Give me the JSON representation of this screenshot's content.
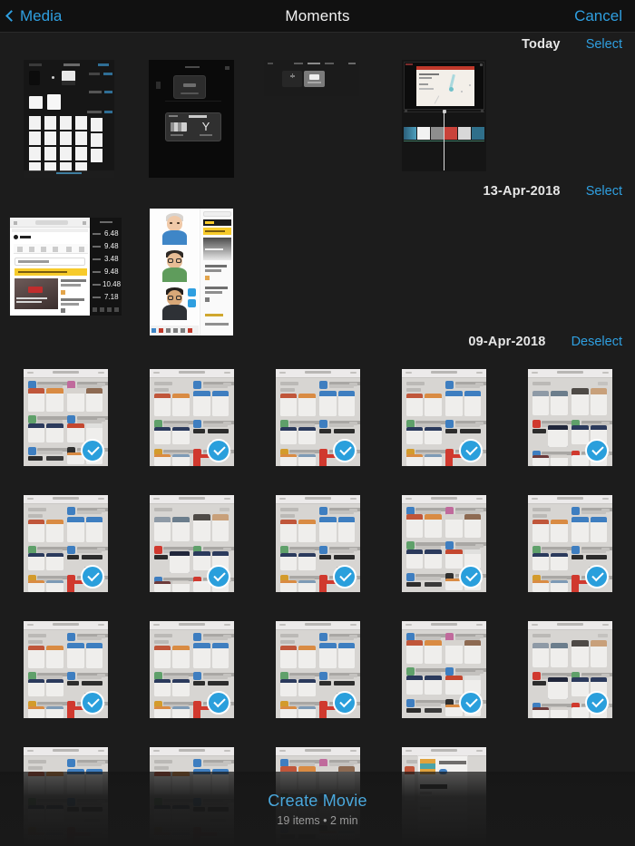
{
  "navbar": {
    "back_label": "Media",
    "back_icon": "chevron-left-icon",
    "title": "Moments",
    "cancel_label": "Cancel"
  },
  "sections": [
    {
      "id": "today",
      "date_label": "Today",
      "action_label": "Select",
      "action_state": "unselected",
      "thumbnails": [
        {
          "id": "t1",
          "kind": "moments-screenshot",
          "selected": false
        },
        {
          "id": "t2",
          "kind": "imovie-new-project-dialog",
          "selected": false
        },
        {
          "id": "t3",
          "kind": "imovie-projects-dark",
          "selected": false
        },
        {
          "id": "t4",
          "kind": "imovie-timeline-map",
          "selected": false
        }
      ]
    },
    {
      "id": "apr13",
      "date_label": "13-Apr-2018",
      "action_label": "Select",
      "action_state": "unselected",
      "thumbnails": [
        {
          "id": "a1",
          "kind": "browser-article-dark-sidebar",
          "selected": false
        },
        {
          "id": "a2",
          "kind": "memoji-avatars",
          "selected": false
        }
      ]
    },
    {
      "id": "apr09",
      "date_label": "09-Apr-2018",
      "action_label": "Deselect",
      "action_state": "selected",
      "thumbnails": [
        {
          "id": "b01",
          "kind": "appstore-a",
          "selected": true
        },
        {
          "id": "b02",
          "kind": "appstore-b",
          "selected": true
        },
        {
          "id": "b03",
          "kind": "appstore-b",
          "selected": true
        },
        {
          "id": "b04",
          "kind": "appstore-b",
          "selected": true
        },
        {
          "id": "b05",
          "kind": "appstore-c",
          "selected": true
        },
        {
          "id": "b06",
          "kind": "appstore-b",
          "selected": true
        },
        {
          "id": "b07",
          "kind": "appstore-c",
          "selected": true
        },
        {
          "id": "b08",
          "kind": "appstore-b",
          "selected": true
        },
        {
          "id": "b09",
          "kind": "appstore-a",
          "selected": true
        },
        {
          "id": "b10",
          "kind": "appstore-b",
          "selected": true
        },
        {
          "id": "b11",
          "kind": "appstore-b",
          "selected": true
        },
        {
          "id": "b12",
          "kind": "appstore-b",
          "selected": true
        },
        {
          "id": "b13",
          "kind": "appstore-b",
          "selected": true
        },
        {
          "id": "b14",
          "kind": "appstore-a",
          "selected": true
        },
        {
          "id": "b15",
          "kind": "appstore-c",
          "selected": true
        },
        {
          "id": "b16",
          "kind": "appstore-b",
          "selected": false
        },
        {
          "id": "b17",
          "kind": "appstore-b",
          "selected": false
        },
        {
          "id": "b18",
          "kind": "appstore-a",
          "selected": false
        },
        {
          "id": "b19",
          "kind": "appstore-detail",
          "selected": false
        }
      ]
    }
  ],
  "bottom_bar": {
    "action_label": "Create Movie",
    "summary": "19 items • 2 min",
    "item_count": 19,
    "duration": "2 min"
  },
  "colors": {
    "background": "#1c1c1c",
    "navbar": "#111111",
    "accent_blue": "#2f9fe0",
    "check_blue": "#2a9fdc",
    "title_text": "#f2f2f2",
    "secondary_text": "#9a9a9a"
  }
}
